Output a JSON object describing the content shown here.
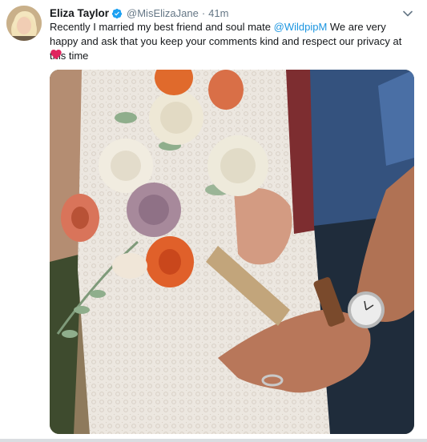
{
  "tweet": {
    "author_name": "Eliza Taylor",
    "handle": "@MisElizaJane",
    "separator": "·",
    "time": "41m",
    "text_before": "Recently I married my best friend and soul mate ",
    "mention": "@WildpipM",
    "text_after": " We are very happy and ask that you keep your comments kind and respect our privacy at this time"
  },
  "icons": {
    "verified": "verified-badge-icon",
    "caret": "chevron-down-icon",
    "heart": "red-heart-emoji"
  },
  "colors": {
    "name": "#14171a",
    "secondary": "#657786",
    "link": "#1b95e0",
    "verified": "#1da1f2",
    "heart": "#e0245e"
  }
}
